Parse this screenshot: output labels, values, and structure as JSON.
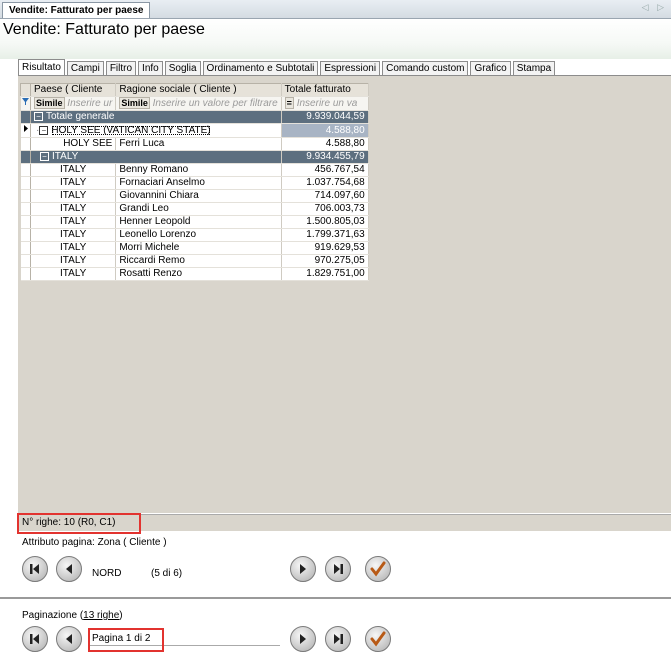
{
  "document_tab": {
    "label": "Vendite: Fatturato per paese",
    "scroll_arrows": "◁ ▷"
  },
  "page_title": "Vendite: Fatturato per paese",
  "tabs": [
    "Risultato",
    "Campi",
    "Filtro",
    "Info",
    "Soglia",
    "Ordinamento e Subtotali",
    "Espressioni",
    "Comando custom",
    "Grafico",
    "Stampa"
  ],
  "grid": {
    "columns": [
      "Paese ( Cliente",
      "Ragione sociale ( Cliente )",
      "Totale fatturato"
    ],
    "filter_row": {
      "op1": "Simile",
      "ph1": "Inserire ur",
      "op2": "Simile",
      "ph2": "Inserire un valore per filtrare",
      "op3": "=",
      "ph3": "Inserire un va"
    },
    "rows": [
      {
        "kind": "group",
        "label": "Totale generale",
        "value": "9.939.044,59"
      },
      {
        "kind": "subgroup",
        "label": "HOLY SEE (VATICAN CITY STATE)",
        "value": "4.588,80"
      },
      {
        "kind": "data",
        "country": "HOLY SEE",
        "company": "Ferri Luca",
        "value": "4.588,80"
      },
      {
        "kind": "group2",
        "label": "ITALY",
        "value": "9.934.455,79"
      },
      {
        "kind": "data",
        "country": "ITALY",
        "company": "Benny Romano",
        "value": "456.767,54"
      },
      {
        "kind": "data",
        "country": "ITALY",
        "company": "Fornaciari Anselmo",
        "value": "1.037.754,68"
      },
      {
        "kind": "data",
        "country": "ITALY",
        "company": "Giovannini Chiara",
        "value": "714.097,60"
      },
      {
        "kind": "data",
        "country": "ITALY",
        "company": "Grandi Leo",
        "value": "706.003,73"
      },
      {
        "kind": "data",
        "country": "ITALY",
        "company": "Henner Leopold",
        "value": "1.500.805,03"
      },
      {
        "kind": "data",
        "country": "ITALY",
        "company": "Leonello Lorenzo",
        "value": "1.799.371,63"
      },
      {
        "kind": "data",
        "country": "ITALY",
        "company": "Morri Michele",
        "value": "919.629,53"
      },
      {
        "kind": "data",
        "country": "ITALY",
        "company": "Riccardi Remo",
        "value": "970.275,05"
      },
      {
        "kind": "data",
        "country": "ITALY",
        "company": "Rosatti Renzo",
        "value": "1.829.751,00"
      }
    ]
  },
  "status": {
    "rows_text": "N° righe: 10  (R0, C1)"
  },
  "page_attribute": {
    "label": "Attributo pagina: Zona ( Cliente )",
    "value": "NORD",
    "count": "(5 di 6)"
  },
  "pagination": {
    "label_prefix": "Paginazione (",
    "label_link": "13 righe",
    "label_suffix": ")",
    "value": "Pagina 1 di 2"
  },
  "colors": {
    "group_row": "#5d6f7f",
    "highlight": "#e2332f",
    "pane_bg": "#d9d5cc"
  }
}
